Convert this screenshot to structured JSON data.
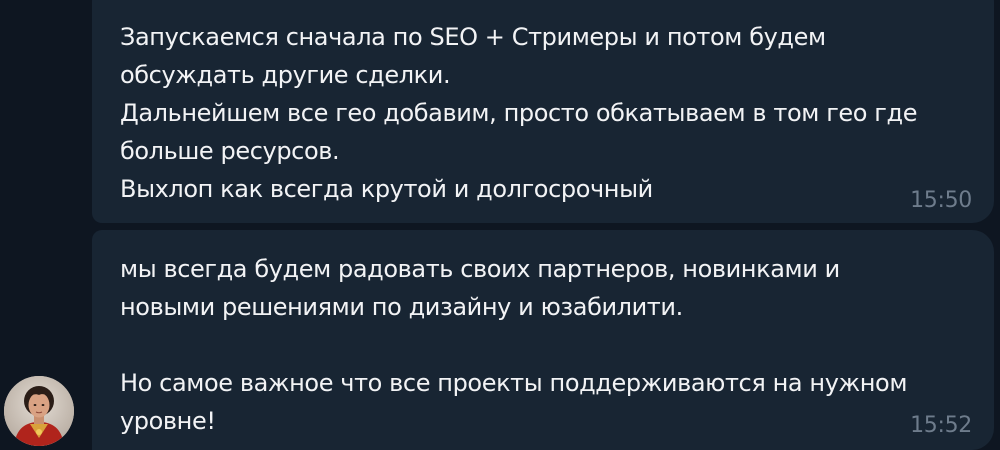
{
  "messages": [
    {
      "text": "Запускаемся сначала по SEO + Стримеры и потом будем\nобсуждать другие сделки.\nДальнейшем все гео добавим, просто обкатываем в том гео где\nбольше ресурсов.\nВыхлоп как всегда крутой и долгосрочный",
      "time": "15:50"
    },
    {
      "text": "мы всегда будем радовать своих партнеров, новинками и\nновыми решениями по дизайну и юзабилити.\n\nНо самое важное что все проекты поддерживаются на нужном\nуровне!",
      "time": "15:52"
    }
  ],
  "colors": {
    "background": "#0e1621",
    "bubble": "#182533",
    "text": "#f2f3f5",
    "timestamp": "#6e7c8c"
  },
  "sender": {
    "avatar_icon": "user-avatar-photo"
  }
}
